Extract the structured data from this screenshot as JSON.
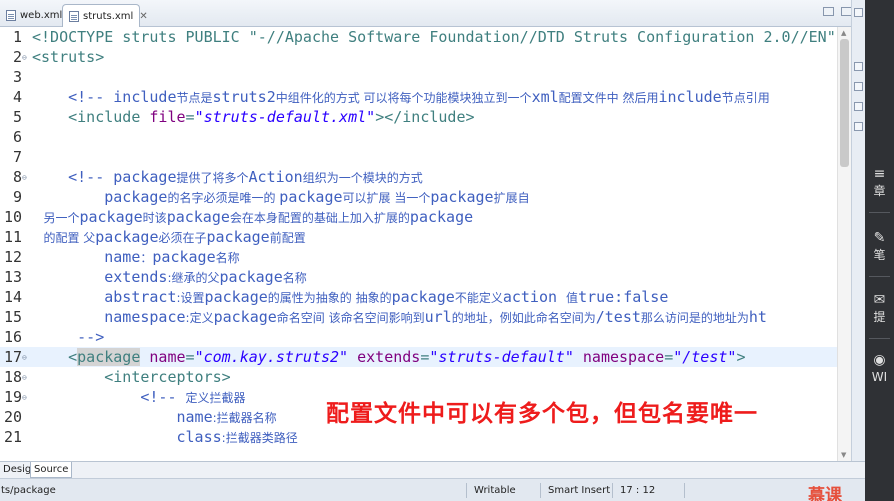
{
  "tabs": [
    {
      "label": "web.xml",
      "active": false
    },
    {
      "label": "struts.xml",
      "active": true
    }
  ],
  "lines": [
    {
      "num": "1",
      "fold": false,
      "current": false,
      "segments": [
        [
          "tag",
          "<!DOCTYPE struts PUBLIC \"-//Apache Software Foundation//DTD Struts Configuration 2.0//EN\""
        ]
      ]
    },
    {
      "num": "2",
      "fold": true,
      "current": false,
      "segments": [
        [
          "tag",
          "<struts>"
        ]
      ]
    },
    {
      "num": "3",
      "fold": false,
      "current": false,
      "segments": []
    },
    {
      "num": "4",
      "fold": false,
      "current": false,
      "segments": [
        [
          "cmt",
          "    <!-- include"
        ],
        [
          "cmt cjk",
          "节点是"
        ],
        [
          "cmt",
          "struts2"
        ],
        [
          "cmt cjk",
          "中组件化的方式 可以将每个功能模块独立到一个"
        ],
        [
          "cmt",
          "xml"
        ],
        [
          "cmt cjk",
          "配置文件中 然后用"
        ],
        [
          "cmt",
          "include"
        ],
        [
          "cmt cjk",
          "节点引用"
        ]
      ]
    },
    {
      "num": "5",
      "fold": false,
      "current": false,
      "segments": [
        [
          "tag",
          "    <include "
        ],
        [
          "attr",
          "file"
        ],
        [
          "tag",
          "="
        ],
        [
          "val",
          "\"struts-default.xml\""
        ],
        [
          "tag",
          "></include>"
        ]
      ]
    },
    {
      "num": "6",
      "fold": false,
      "current": false,
      "segments": []
    },
    {
      "num": "7",
      "fold": false,
      "current": false,
      "segments": []
    },
    {
      "num": "8",
      "fold": true,
      "current": false,
      "segments": [
        [
          "cmt",
          "    <!-- package"
        ],
        [
          "cmt cjk",
          "提供了将多个"
        ],
        [
          "cmt",
          "Action"
        ],
        [
          "cmt cjk",
          "组织为一个模块的方式"
        ]
      ]
    },
    {
      "num": "9",
      "fold": false,
      "current": false,
      "segments": [
        [
          "cmt",
          "        package"
        ],
        [
          "cmt cjk",
          "的名字必须是唯一的 "
        ],
        [
          "cmt",
          "package"
        ],
        [
          "cmt cjk",
          "可以扩展 当一个"
        ],
        [
          "cmt",
          "package"
        ],
        [
          "cmt cjk",
          "扩展自"
        ]
      ]
    },
    {
      "num": "10",
      "fold": false,
      "current": false,
      "segments": [
        [
          "cmt cjk",
          "   另一个"
        ],
        [
          "cmt",
          "package"
        ],
        [
          "cmt cjk",
          "时该"
        ],
        [
          "cmt",
          "package"
        ],
        [
          "cmt cjk",
          "会在本身配置的基础上加入扩展的"
        ],
        [
          "cmt",
          "package"
        ]
      ]
    },
    {
      "num": "11",
      "fold": false,
      "current": false,
      "segments": [
        [
          "cmt cjk",
          "   的配置 父"
        ],
        [
          "cmt",
          "package"
        ],
        [
          "cmt cjk",
          "必须在子"
        ],
        [
          "cmt",
          "package"
        ],
        [
          "cmt cjk",
          "前配置"
        ]
      ]
    },
    {
      "num": "12",
      "fold": false,
      "current": false,
      "segments": [
        [
          "cmt",
          "        name"
        ],
        [
          "cmt cjk",
          "："
        ],
        [
          "cmt",
          "package"
        ],
        [
          "cmt cjk",
          "名称"
        ]
      ]
    },
    {
      "num": "13",
      "fold": false,
      "current": false,
      "segments": [
        [
          "cmt",
          "        extends"
        ],
        [
          "cmt cjk",
          ":继承的父"
        ],
        [
          "cmt",
          "package"
        ],
        [
          "cmt cjk",
          "名称"
        ]
      ]
    },
    {
      "num": "14",
      "fold": false,
      "current": false,
      "segments": [
        [
          "cmt",
          "        abstract"
        ],
        [
          "cmt cjk",
          ":设置"
        ],
        [
          "cmt",
          "package"
        ],
        [
          "cmt cjk",
          "的属性为抽象的 抽象的"
        ],
        [
          "cmt",
          "package"
        ],
        [
          "cmt cjk",
          "不能定义"
        ],
        [
          "cmt",
          "action "
        ],
        [
          "cmt cjk",
          "值"
        ],
        [
          "cmt",
          "true:false"
        ]
      ]
    },
    {
      "num": "15",
      "fold": false,
      "current": false,
      "segments": [
        [
          "cmt",
          "        namespace"
        ],
        [
          "cmt cjk",
          ":定义"
        ],
        [
          "cmt",
          "package"
        ],
        [
          "cmt cjk",
          "命名空间 该命名空间影响到"
        ],
        [
          "cmt",
          "url"
        ],
        [
          "cmt cjk",
          "的地址，例如此命名空间为"
        ],
        [
          "cmt",
          "/test"
        ],
        [
          "cmt cjk",
          "那么访问是的地址为"
        ],
        [
          "cmt",
          "ht"
        ]
      ]
    },
    {
      "num": "16",
      "fold": false,
      "current": false,
      "segments": [
        [
          "cmt",
          "     -->"
        ]
      ]
    },
    {
      "num": "17",
      "fold": true,
      "current": true,
      "segments": [
        [
          "tag",
          "    <"
        ],
        [
          "tag hl",
          "package"
        ],
        [
          "tag",
          " "
        ],
        [
          "attr",
          "name"
        ],
        [
          "tag",
          "="
        ],
        [
          "val",
          "\"com.kay.struts2\""
        ],
        [
          "tag",
          " "
        ],
        [
          "attr",
          "extends"
        ],
        [
          "tag",
          "="
        ],
        [
          "val",
          "\"struts-default\""
        ],
        [
          "tag",
          " "
        ],
        [
          "attr",
          "namespace"
        ],
        [
          "tag",
          "="
        ],
        [
          "val",
          "\"/test\""
        ],
        [
          "tag",
          ">"
        ]
      ]
    },
    {
      "num": "18",
      "fold": true,
      "current": false,
      "segments": [
        [
          "tag",
          "        <interceptors>"
        ]
      ]
    },
    {
      "num": "19",
      "fold": true,
      "current": false,
      "segments": [
        [
          "cmt",
          "            <!-- "
        ],
        [
          "cmt cjk",
          "定义拦截器"
        ]
      ]
    },
    {
      "num": "20",
      "fold": false,
      "current": false,
      "segments": [
        [
          "cmt",
          "                name"
        ],
        [
          "cmt cjk",
          ":拦截器名称"
        ]
      ]
    },
    {
      "num": "21",
      "fold": false,
      "current": false,
      "segments": [
        [
          "cmt",
          "                class"
        ],
        [
          "cmt cjk",
          ":拦截器类路径"
        ]
      ]
    }
  ],
  "bottom_tabs": {
    "design": "Design",
    "source": "Source"
  },
  "status": {
    "path": "ts/package",
    "mode": "Writable",
    "insert": "Smart Insert",
    "position": "17 : 12"
  },
  "logo_text": "慕课",
  "caption": "配置文件中可以有多个包，但包名要唯一",
  "player_panel": [
    {
      "icon": "≡",
      "label": "章",
      "icon_name": "menu-icon"
    },
    {
      "icon": "✎",
      "label": "笔",
      "icon_name": "pencil-icon"
    },
    {
      "icon": "✉",
      "label": "提",
      "icon_name": "message-icon"
    },
    {
      "icon": "◉",
      "label": "WI",
      "icon_name": "wifi-icon"
    }
  ],
  "colors": {
    "tag": "#3f7f7f",
    "attribute": "#7f007f",
    "value": "#2a00ff",
    "comment": "#3f5fbf",
    "caption": "#ee1c1c",
    "current_line": "#e8f2fe"
  }
}
